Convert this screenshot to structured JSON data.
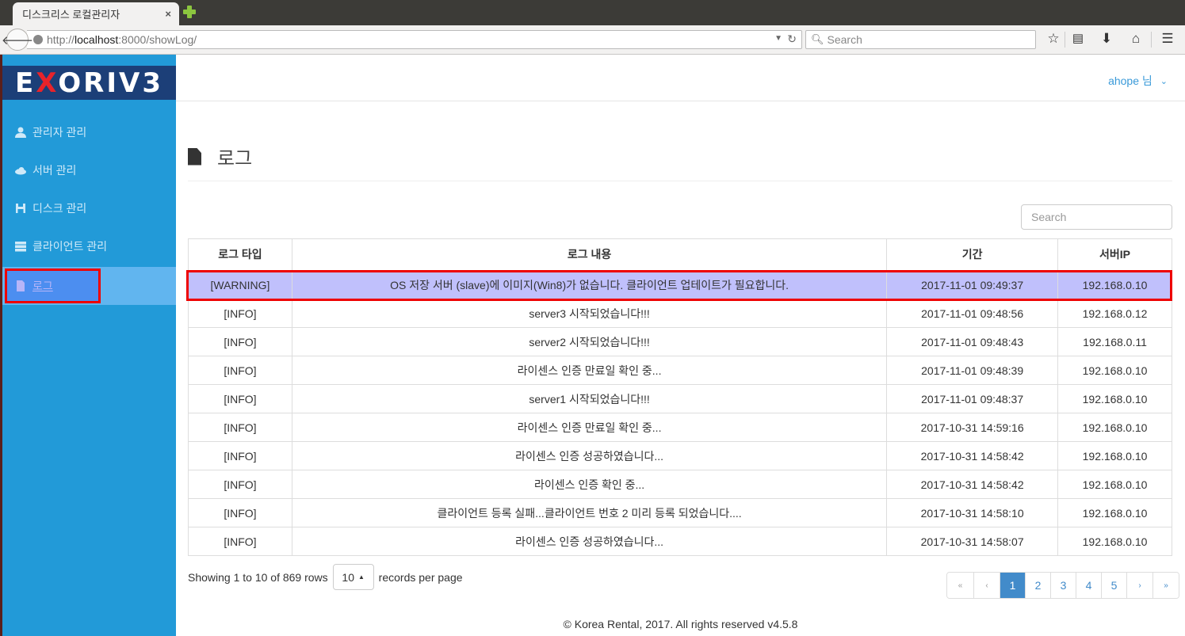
{
  "browser": {
    "tab_title": "디스크리스 로컬관리자",
    "tab_close": "×",
    "url_prefix": "http://",
    "url_host": "localhost",
    "url_rest": ":8000/showLog/",
    "search_placeholder": "Search",
    "icons": [
      "bookmark-star-icon",
      "reading-list-icon",
      "download-icon",
      "home-icon",
      "menu-icon"
    ]
  },
  "app": {
    "logo_text_left": "E",
    "logo_text_x": "X",
    "logo_text_right": "ORIV3",
    "user": "ahope 님",
    "user_chevron": "⌄"
  },
  "sidebar": {
    "items": [
      {
        "label": "관리자 관리",
        "icon": "user-icon"
      },
      {
        "label": "서버 관리",
        "icon": "cloud-icon"
      },
      {
        "label": "디스크 관리",
        "icon": "floppy-disk-icon"
      },
      {
        "label": "클라이언트 관리",
        "icon": "server-stack-icon"
      },
      {
        "label": "로그",
        "icon": "document-icon",
        "active": true
      }
    ]
  },
  "page": {
    "title": "로그",
    "search_placeholder": "Search"
  },
  "table": {
    "columns": [
      "로그 타입",
      "로그 내용",
      "기간",
      "서버IP"
    ],
    "rows": [
      {
        "type": "[WARNING]",
        "message": "OS 저장 서버 (slave)에 이미지(Win8)가 없습니다. 클라이언트 업테이트가 필요합니다.",
        "time": "2017-11-01 09:49:37",
        "ip": "192.168.0.10",
        "selected": true
      },
      {
        "type": "[INFO]",
        "message": "server3 시작되었습니다!!!",
        "time": "2017-11-01 09:48:56",
        "ip": "192.168.0.12"
      },
      {
        "type": "[INFO]",
        "message": "server2 시작되었습니다!!!",
        "time": "2017-11-01 09:48:43",
        "ip": "192.168.0.11"
      },
      {
        "type": "[INFO]",
        "message": "라이센스 인증 만료일 확인 중...",
        "time": "2017-11-01 09:48:39",
        "ip": "192.168.0.10"
      },
      {
        "type": "[INFO]",
        "message": "server1 시작되었습니다!!!",
        "time": "2017-11-01 09:48:37",
        "ip": "192.168.0.10"
      },
      {
        "type": "[INFO]",
        "message": "라이센스 인증 만료일 확인 중...",
        "time": "2017-10-31 14:59:16",
        "ip": "192.168.0.10"
      },
      {
        "type": "[INFO]",
        "message": "라이센스 인증 성공하였습니다...",
        "time": "2017-10-31 14:58:42",
        "ip": "192.168.0.10"
      },
      {
        "type": "[INFO]",
        "message": "라이센스 인증 확인 중...",
        "time": "2017-10-31 14:58:42",
        "ip": "192.168.0.10"
      },
      {
        "type": "[INFO]",
        "message": "클라이언트 등록 실패...클라이언트 번호 2 미리 등록 되었습니다....",
        "time": "2017-10-31 14:58:10",
        "ip": "192.168.0.10"
      },
      {
        "type": "[INFO]",
        "message": "라이센스 인증 성공하였습니다...",
        "time": "2017-10-31 14:58:07",
        "ip": "192.168.0.10"
      }
    ]
  },
  "pager": {
    "info": "Showing 1 to 10 of 869 rows",
    "page_size": "10",
    "page_size_suffix": "records per page",
    "first": "«",
    "prev": "‹",
    "pages": [
      "1",
      "2",
      "3",
      "4",
      "5"
    ],
    "current_page": "1",
    "next": "›",
    "last": "»"
  },
  "footer": "© Korea Rental, 2017. All rights reserved v4.5.8",
  "colors": {
    "sidebar_bg": "#229ad8",
    "logo_bg": "#1c3f78",
    "selected_row": "#c0c0fc",
    "highlight_border": "#ee0000",
    "link_blue": "#428bca"
  }
}
